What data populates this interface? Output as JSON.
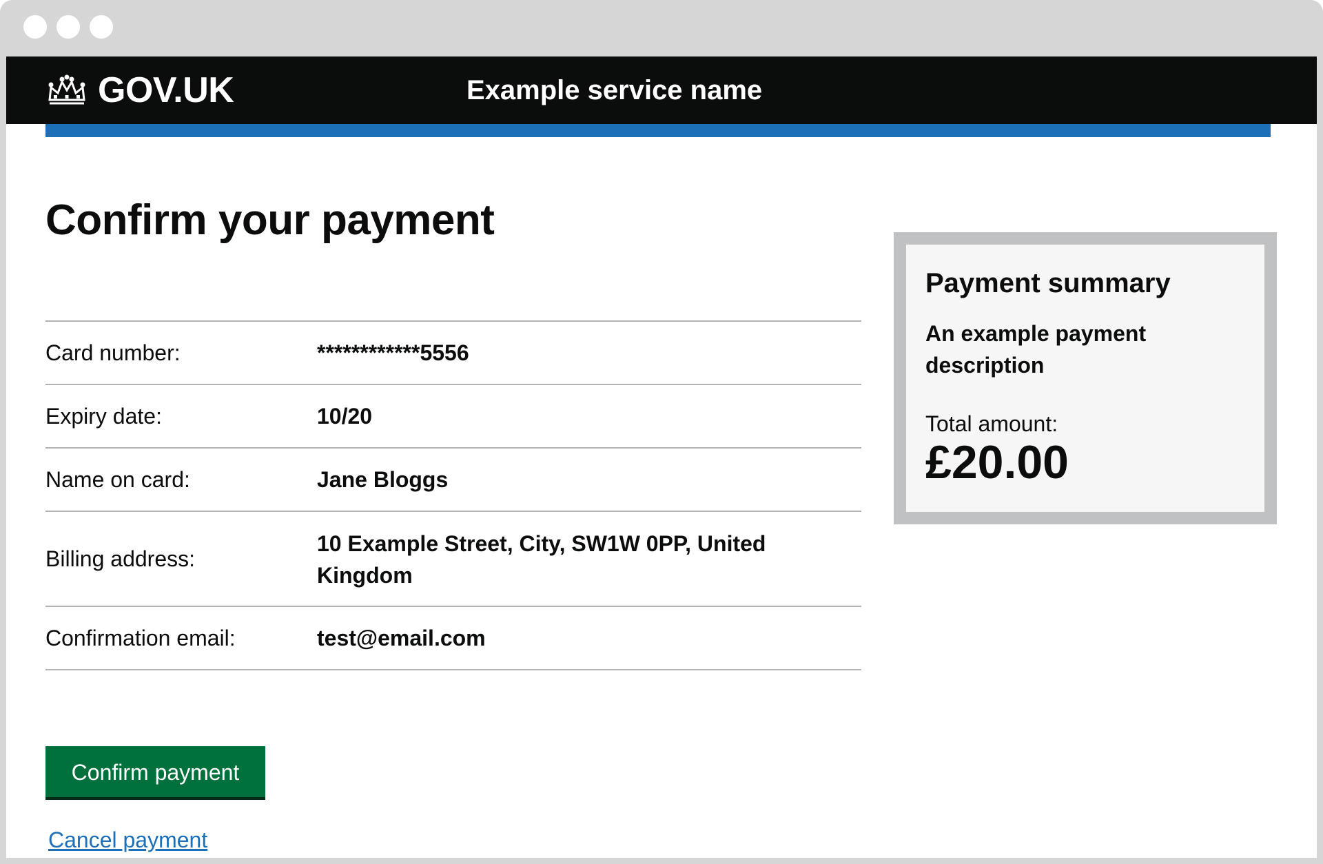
{
  "header": {
    "logo_text": "GOV.UK",
    "service_name": "Example service name"
  },
  "page": {
    "title": "Confirm your payment"
  },
  "summary": {
    "rows": [
      {
        "key": "Card number:",
        "value": "************5556"
      },
      {
        "key": "Expiry date:",
        "value": "10/20"
      },
      {
        "key": "Name on card:",
        "value": "Jane Bloggs"
      },
      {
        "key": "Billing address:",
        "value": "10 Example Street, City, SW1W 0PP, United Kingdom"
      },
      {
        "key": "Confirmation email:",
        "value": "test@email.com"
      }
    ]
  },
  "actions": {
    "confirm_label": "Confirm payment",
    "cancel_label": "Cancel payment"
  },
  "panel": {
    "title": "Payment summary",
    "description": "An example payment description",
    "total_label": "Total amount:",
    "amount": "£20.00"
  },
  "colors": {
    "header_bg": "#0b0c0c",
    "accent_bar": "#1d70b8",
    "button_green": "#00703c",
    "link_blue": "#1d70b8",
    "panel_border": "#bfc1c3",
    "panel_bg": "#f6f6f6"
  },
  "icons": {
    "logo": "crown-icon"
  }
}
